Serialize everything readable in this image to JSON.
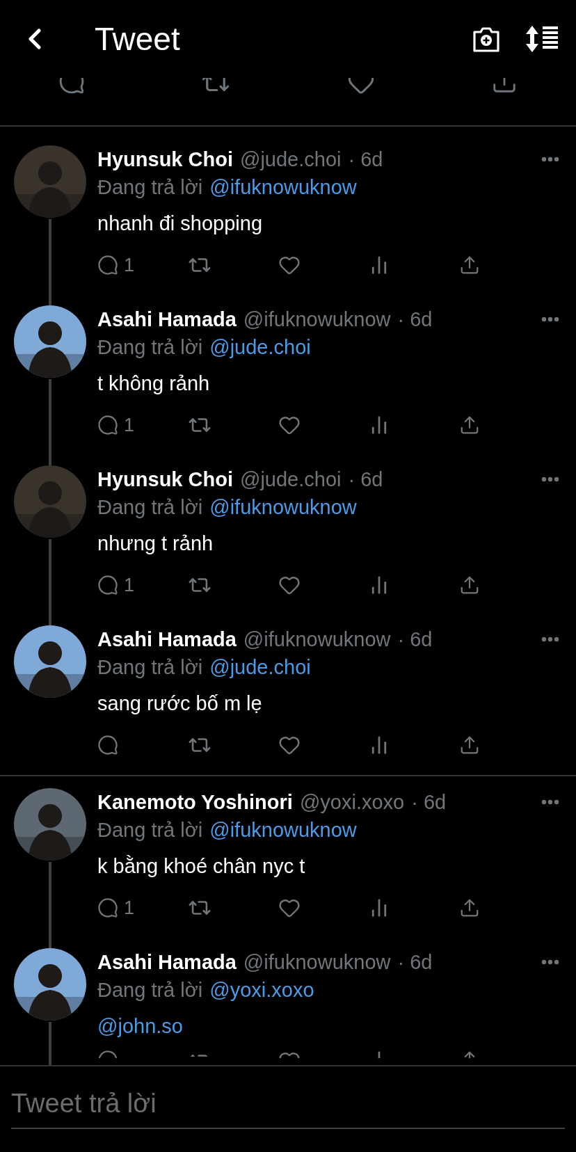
{
  "header": {
    "title": "Tweet"
  },
  "threads": [
    {
      "tweets": [
        {
          "name": "Hyunsuk Choi",
          "handle": "@jude.choi",
          "time": "· 6d",
          "reply_prefix": "Đang trả lời",
          "reply_to": "@ifuknowuknow",
          "text": "nhanh đi shopping",
          "reply_count": "1",
          "thread_line": true,
          "color": "#3a332c"
        },
        {
          "name": "Asahi Hamada",
          "handle": "@ifuknowuknow",
          "time": "· 6d",
          "reply_prefix": "Đang trả lời",
          "reply_to": "@jude.choi",
          "text": "t không rảnh",
          "reply_count": "1",
          "thread_line": true,
          "color": "#7fa9d6"
        },
        {
          "name": "Hyunsuk Choi",
          "handle": "@jude.choi",
          "time": "· 6d",
          "reply_prefix": "Đang trả lời",
          "reply_to": "@ifuknowuknow",
          "text": "nhưng t rảnh",
          "reply_count": "1",
          "thread_line": true,
          "color": "#3a332c"
        },
        {
          "name": "Asahi Hamada",
          "handle": "@ifuknowuknow",
          "time": "· 6d",
          "reply_prefix": "Đang trả lời",
          "reply_to": "@jude.choi",
          "text": "sang rước bố m lẹ",
          "thread_line": false,
          "color": "#7fa9d6"
        }
      ]
    },
    {
      "tweets": [
        {
          "name": "Kanemoto Yoshinori",
          "handle": "@yoxi.xoxo",
          "time": "· 6d",
          "reply_prefix": "Đang trả lời",
          "reply_to": "@ifuknowuknow",
          "text": "k bằng khoé chân nyc t",
          "reply_count": "1",
          "thread_line": true,
          "color": "#5e6872"
        },
        {
          "name": "Asahi Hamada",
          "handle": "@ifuknowuknow",
          "time": "· 6d",
          "reply_prefix": "Đang trả lời",
          "reply_to": "@yoxi.xoxo",
          "mention": "@john.so",
          "cut_off": true,
          "thread_line": true,
          "color": "#7fa9d6"
        }
      ]
    }
  ],
  "composer": {
    "placeholder": "Tweet trả lời"
  }
}
